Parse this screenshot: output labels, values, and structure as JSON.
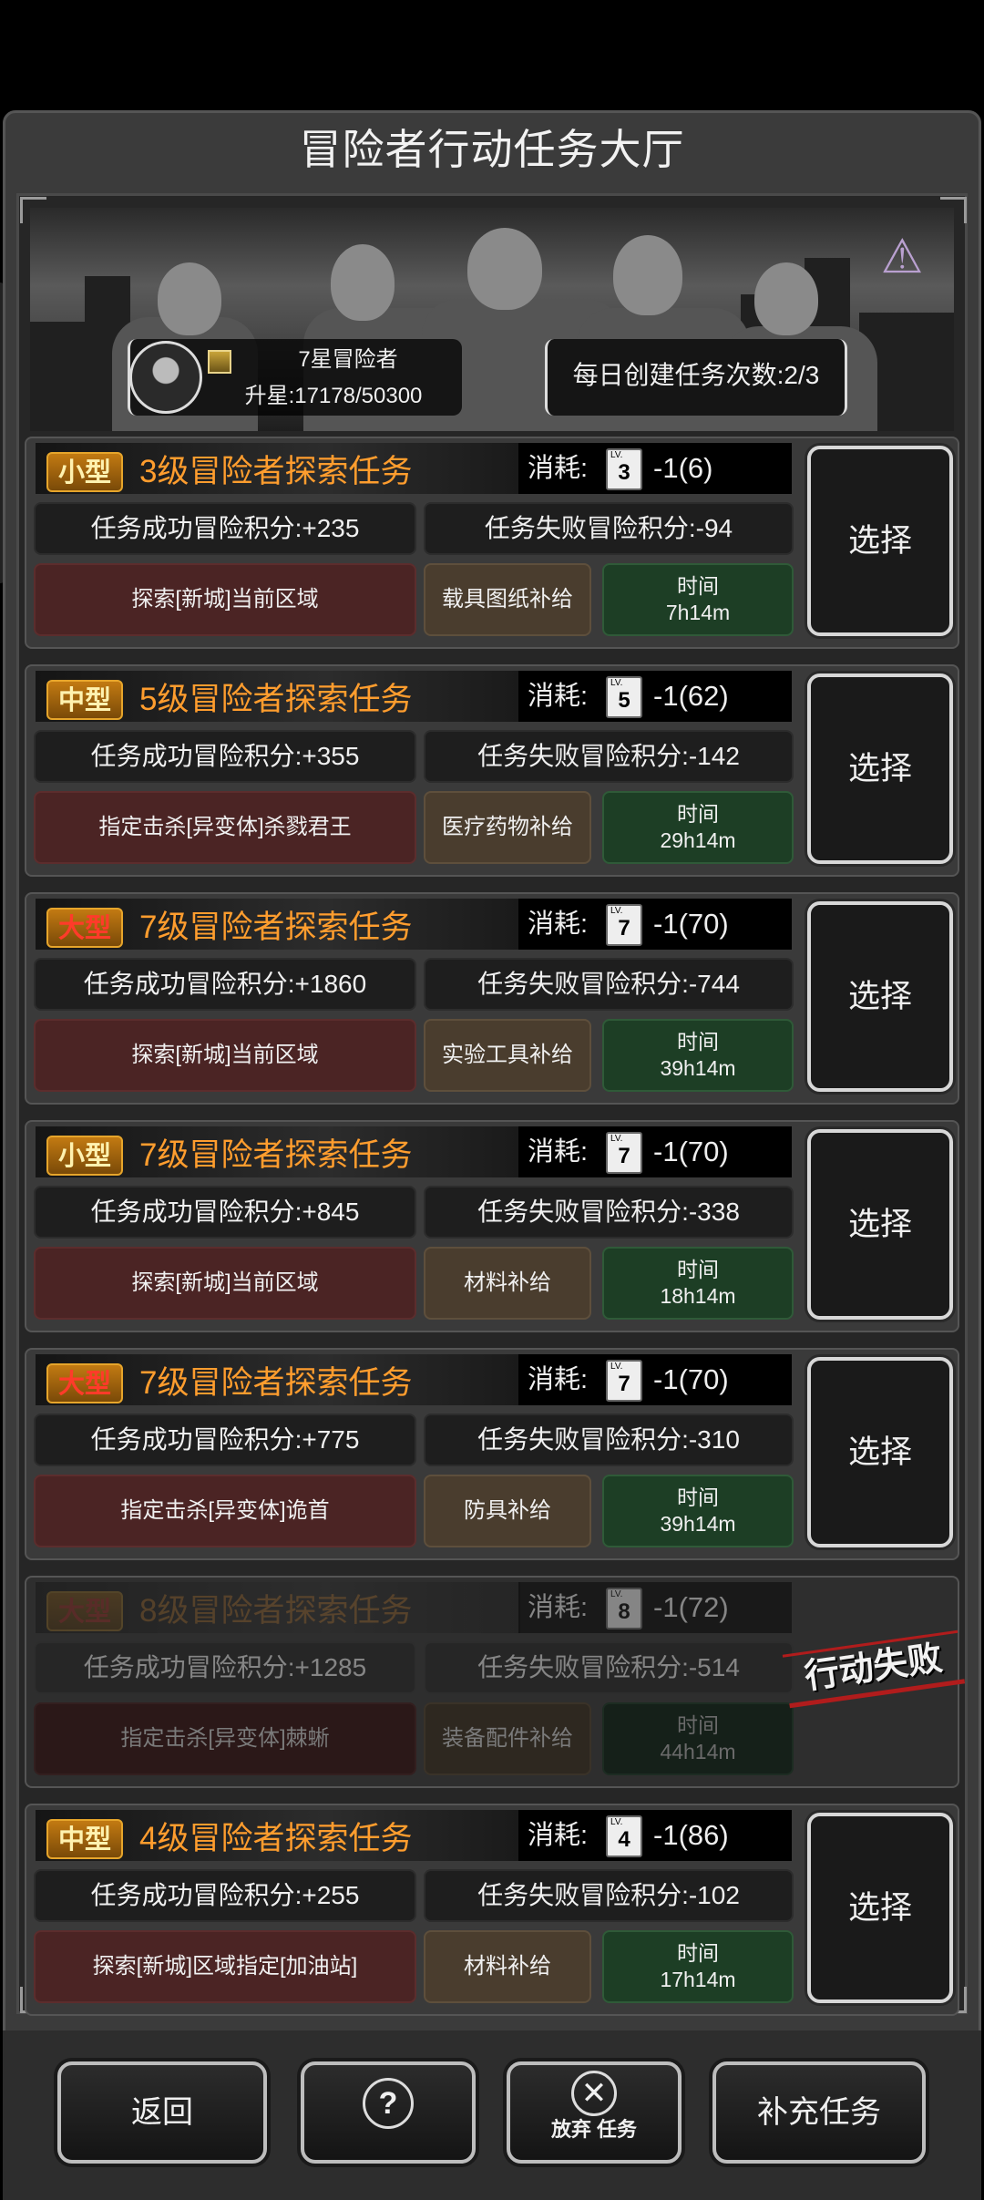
{
  "title": "冒险者行动任务大厅",
  "player": {
    "rank": "7星冒险者",
    "promote": "升星:17178/50300"
  },
  "daily": "每日创建任务次数:2/3",
  "labels": {
    "cost": "消耗:",
    "select": "选择",
    "time": "时间",
    "lv": "LV."
  },
  "missions": [
    {
      "size": "小型",
      "title": "3级冒险者探索任务",
      "level": "3",
      "cost": "-1(6)",
      "success": "任务成功冒险积分:+235",
      "fail": "任务失败冒险积分:-94",
      "target": "探索[新城]当前区域",
      "supply": "载具图纸补给",
      "time": "7h14m",
      "status": "available"
    },
    {
      "size": "中型",
      "title": "5级冒险者探索任务",
      "level": "5",
      "cost": "-1(62)",
      "success": "任务成功冒险积分:+355",
      "fail": "任务失败冒险积分:-142",
      "target": "指定击杀[异变体]杀戮君王",
      "supply": "医疗药物补给",
      "time": "29h14m",
      "status": "available"
    },
    {
      "size": "大型",
      "title": "7级冒险者探索任务",
      "level": "7",
      "cost": "-1(70)",
      "success": "任务成功冒险积分:+1860",
      "fail": "任务失败冒险积分:-744",
      "target": "探索[新城]当前区域",
      "supply": "实验工具补给",
      "time": "39h14m",
      "status": "available"
    },
    {
      "size": "小型",
      "title": "7级冒险者探索任务",
      "level": "7",
      "cost": "-1(70)",
      "success": "任务成功冒险积分:+845",
      "fail": "任务失败冒险积分:-338",
      "target": "探索[新城]当前区域",
      "supply": "材料补给",
      "time": "18h14m",
      "status": "available"
    },
    {
      "size": "大型",
      "title": "7级冒险者探索任务",
      "level": "7",
      "cost": "-1(70)",
      "success": "任务成功冒险积分:+775",
      "fail": "任务失败冒险积分:-310",
      "target": "指定击杀[异变体]诡首",
      "supply": "防具补给",
      "time": "39h14m",
      "status": "available"
    },
    {
      "size": "大型",
      "title": "8级冒险者探索任务",
      "level": "8",
      "cost": "-1(72)",
      "success": "任务成功冒险积分:+1285",
      "fail": "任务失败冒险积分:-514",
      "target": "指定击杀[异变体]棘蜥",
      "supply": "装备配件补给",
      "time": "44h14m",
      "status": "failed"
    },
    {
      "size": "中型",
      "title": "4级冒险者探索任务",
      "level": "4",
      "cost": "-1(86)",
      "success": "任务成功冒险积分:+255",
      "fail": "任务失败冒险积分:-102",
      "target": "探索[新城]区域指定[加油站]",
      "supply": "材料补给",
      "time": "17h14m",
      "status": "available"
    }
  ],
  "fail_stamp": "行动失败",
  "bottom": {
    "back": "返回",
    "help_icon": "?",
    "abandon_icon": "✕",
    "abandon": "放弃 任务",
    "refill": "补充任务"
  },
  "colors": {
    "accent": "#ff9d2e",
    "badge_red": "#ff3b2a",
    "target_bg": "#4b2424",
    "supply_bg": "#4a3d2e",
    "time_bg": "#1d3e25"
  }
}
